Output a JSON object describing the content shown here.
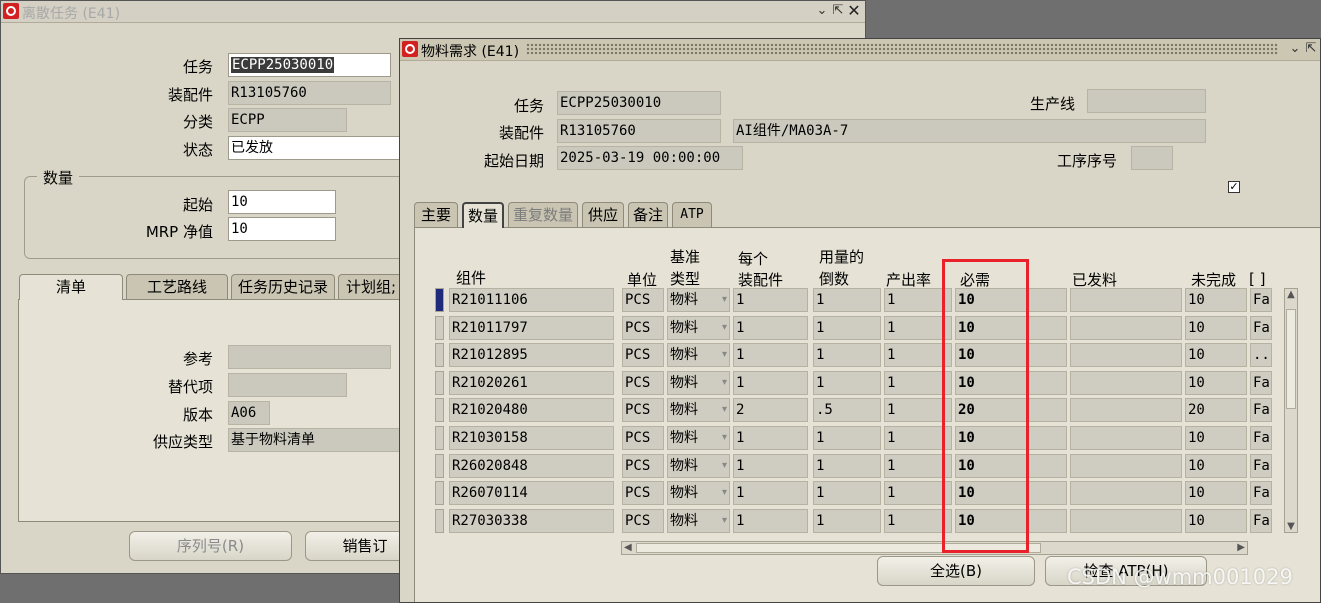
{
  "back_window": {
    "title": "离散任务 (E41)",
    "fields": {
      "task_label": "任务",
      "task_value": "ECPP25030010",
      "assembly_label": "装配件",
      "assembly_value": "R13105760",
      "class_label": "分类",
      "class_value": "ECPP",
      "status_label": "状态",
      "status_value": "已发放"
    },
    "quantity_group": {
      "title": "数量",
      "start_label": "起始",
      "start_value": "10",
      "mrp_label": "MRP 净值",
      "mrp_value": "10"
    },
    "tabs": [
      "清单",
      "工艺路线",
      "任务历史记录",
      "计划组;"
    ],
    "bom": {
      "ref_label": "参考",
      "ref_value": "",
      "alt_label": "替代项",
      "alt_value": "",
      "rev_label": "版本",
      "rev_value": "A06",
      "supply_label": "供应类型",
      "supply_value": "基于物料清单"
    },
    "buttons": {
      "serial": "序列号(R)",
      "sales": "销售订"
    }
  },
  "front_window": {
    "title": "物料需求 (E41)",
    "header": {
      "task_label": "任务",
      "task_value": "ECPP25030010",
      "assembly_label": "装配件",
      "assembly_value": "R13105760",
      "assembly_desc": "AI组件/MA03A-7",
      "start_date_label": "起始日期",
      "start_date_value": "2025-03-19 00:00:00",
      "line_label": "生产线",
      "line_value": "",
      "op_seq_label": "工序序号",
      "op_seq_value": ""
    },
    "tabs": [
      "主要",
      "数量",
      "重复数量",
      "供应",
      "备注",
      "ATP"
    ],
    "active_tab": "数量",
    "columns": {
      "component": "组件",
      "uom": "单位",
      "basis_1": "基准",
      "basis_2": "类型",
      "per_assy_1": "每个",
      "per_assy_2": "装配件",
      "inverse_1": "用量的",
      "inverse_2": "倒数",
      "yield": "产出率",
      "required": "必需",
      "issued": "已发料",
      "open": "未完成"
    },
    "rows": [
      {
        "component": "R21011106",
        "uom": "PCS",
        "basis": "物料",
        "per_assy": "1",
        "inverse": "1",
        "yield": "1",
        "required": "10",
        "issued": "",
        "open": "10",
        "extra": "Fa"
      },
      {
        "component": "R21011797",
        "uom": "PCS",
        "basis": "物料",
        "per_assy": "1",
        "inverse": "1",
        "yield": "1",
        "required": "10",
        "issued": "",
        "open": "10",
        "extra": "Fa"
      },
      {
        "component": "R21012895",
        "uom": "PCS",
        "basis": "物料",
        "per_assy": "1",
        "inverse": "1",
        "yield": "1",
        "required": "10",
        "issued": "",
        "open": "10",
        "extra": ".."
      },
      {
        "component": "R21020261",
        "uom": "PCS",
        "basis": "物料",
        "per_assy": "1",
        "inverse": "1",
        "yield": "1",
        "required": "10",
        "issued": "",
        "open": "10",
        "extra": "Fa"
      },
      {
        "component": "R21020480",
        "uom": "PCS",
        "basis": "物料",
        "per_assy": "2",
        "inverse": ".5",
        "yield": "1",
        "required": "20",
        "issued": "",
        "open": "20",
        "extra": "Fa"
      },
      {
        "component": "R21030158",
        "uom": "PCS",
        "basis": "物料",
        "per_assy": "1",
        "inverse": "1",
        "yield": "1",
        "required": "10",
        "issued": "",
        "open": "10",
        "extra": "Fa"
      },
      {
        "component": "R26020848",
        "uom": "PCS",
        "basis": "物料",
        "per_assy": "1",
        "inverse": "1",
        "yield": "1",
        "required": "10",
        "issued": "",
        "open": "10",
        "extra": "Fa"
      },
      {
        "component": "R26070114",
        "uom": "PCS",
        "basis": "物料",
        "per_assy": "1",
        "inverse": "1",
        "yield": "1",
        "required": "10",
        "issued": "",
        "open": "10",
        "extra": "Fa"
      },
      {
        "component": "R27030338",
        "uom": "PCS",
        "basis": "物料",
        "per_assy": "1",
        "inverse": "1",
        "yield": "1",
        "required": "10",
        "issued": "",
        "open": "10",
        "extra": "Fa"
      }
    ],
    "buttons": {
      "select_all": "全选(B)",
      "check_atp": "检查 ATP(H)"
    }
  },
  "watermark": "CSDN @wmm001029",
  "colors": {
    "highlight_box": "#e8212b",
    "current_row": "#1d2b7a"
  }
}
